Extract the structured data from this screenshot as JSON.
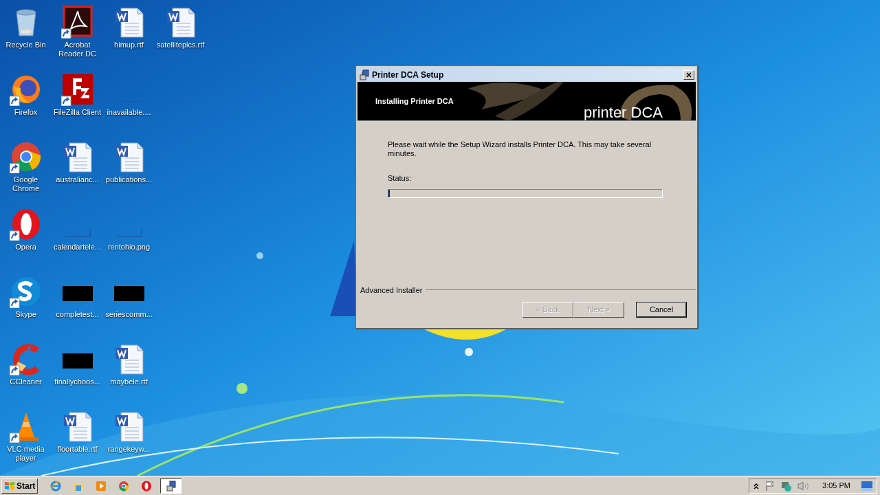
{
  "desktop_icons": [
    [
      {
        "label": "Recycle Bin",
        "kind": "recycle",
        "shortcut": false
      },
      {
        "label": "Acrobat Reader DC",
        "kind": "acrobat",
        "shortcut": true
      },
      {
        "label": "himup.rtf",
        "kind": "word",
        "shortcut": false
      },
      {
        "label": "satellitepics.rtf",
        "kind": "word",
        "shortcut": false
      }
    ],
    [
      {
        "label": "Firefox",
        "kind": "firefox",
        "shortcut": true
      },
      {
        "label": "FileZilla Client",
        "kind": "filezilla",
        "shortcut": true
      },
      {
        "label": "inavailable....",
        "kind": "blank",
        "shortcut": false
      }
    ],
    [
      {
        "label": "Google Chrome",
        "kind": "chrome",
        "shortcut": true
      },
      {
        "label": "australianc...",
        "kind": "word",
        "shortcut": false
      },
      {
        "label": "publications...",
        "kind": "word",
        "shortcut": false
      }
    ],
    [
      {
        "label": "Opera",
        "kind": "opera",
        "shortcut": true
      },
      {
        "label": "calendartele...",
        "kind": "blank",
        "shortcut": false
      },
      {
        "label": "rentohio.png",
        "kind": "blank",
        "shortcut": false
      }
    ],
    [
      {
        "label": "Skype",
        "kind": "skype",
        "shortcut": true
      },
      {
        "label": "completest...",
        "kind": "black",
        "shortcut": false
      },
      {
        "label": "seriescomm...",
        "kind": "black",
        "shortcut": false
      }
    ],
    [
      {
        "label": "CCleaner",
        "kind": "ccleaner",
        "shortcut": true
      },
      {
        "label": "finallychoos...",
        "kind": "black",
        "shortcut": false
      },
      {
        "label": "maybele.rtf",
        "kind": "word",
        "shortcut": false
      }
    ],
    [
      {
        "label": "VLC media player",
        "kind": "vlc",
        "shortcut": true
      },
      {
        "label": "floortable.rtf",
        "kind": "word",
        "shortcut": false
      },
      {
        "label": "rangekeyw...",
        "kind": "word",
        "shortcut": false
      }
    ]
  ],
  "dialog": {
    "title": "Printer DCA Setup",
    "banner_heading": "Installing Printer DCA",
    "banner_logo": "printer DCA",
    "message": "Please wait while the Setup Wizard installs Printer DCA.  This may take several minutes.",
    "status_label": "Status:",
    "progress": {
      "level": 0.005
    },
    "footer_brand": "Advanced Installer",
    "buttons": [
      {
        "label": "< Back",
        "disabled": true,
        "default": false
      },
      {
        "label": "Next >",
        "disabled": true,
        "default": false
      },
      {
        "label": "Cancel",
        "disabled": false,
        "default": true
      }
    ]
  },
  "taskbar": {
    "start": "Start",
    "quick_launch": [
      {
        "kind": "ie"
      },
      {
        "kind": "explorer"
      },
      {
        "kind": "media"
      },
      {
        "kind": "chrome"
      },
      {
        "kind": "opera"
      }
    ],
    "tasks": [
      {
        "kind": "installer",
        "selected": true
      }
    ],
    "clock": "3:05 PM"
  }
}
